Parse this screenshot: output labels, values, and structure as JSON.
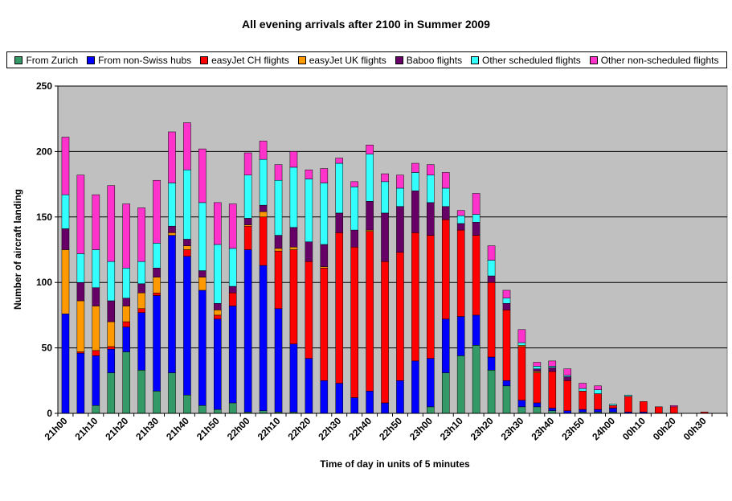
{
  "chart_data": {
    "type": "bar",
    "stacked": true,
    "title": "All evening arrivals after 2100 in Summer 2009",
    "xlabel": "Time of day in units of 5 minutes",
    "ylabel": "Number of aircraft landing",
    "ylim": [
      0,
      250
    ],
    "yticks": [
      0,
      50,
      100,
      150,
      200,
      250
    ],
    "grid": true,
    "legend_position": "top",
    "x_tick_labels": [
      "21h00",
      "21h10",
      "21h20",
      "21h30",
      "21h40",
      "21h50",
      "22h00",
      "22h10",
      "22h20",
      "22h30",
      "22h40",
      "22h50",
      "23h00",
      "23h10",
      "23h20",
      "23h30",
      "23h40",
      "23h50",
      "24h00",
      "00h10",
      "00h20",
      "00h30"
    ],
    "x_tick_every": 2,
    "categories": [
      "21h00",
      "21h05",
      "21h10",
      "21h15",
      "21h20",
      "21h25",
      "21h30",
      "21h35",
      "21h40",
      "21h45",
      "21h50",
      "21h55",
      "22h00",
      "22h05",
      "22h10",
      "22h15",
      "22h20",
      "22h25",
      "22h30",
      "22h35",
      "22h40",
      "22h45",
      "22h50",
      "22h55",
      "23h00",
      "23h05",
      "23h10",
      "23h15",
      "23h20",
      "23h25",
      "23h30",
      "23h35",
      "23h40",
      "23h45",
      "23h50",
      "23h55",
      "24h00",
      "00h05",
      "00h10",
      "00h15",
      "00h20",
      "00h25",
      "00h30",
      "00h35"
    ],
    "series": [
      {
        "name": "From Zurich",
        "color": "#339966",
        "values": [
          0,
          0,
          6,
          31,
          47,
          33,
          17,
          31,
          14,
          6,
          3,
          8,
          1,
          2,
          1,
          1,
          0,
          0,
          0,
          0,
          0,
          0,
          0,
          0,
          5,
          31,
          44,
          52,
          33,
          21,
          5,
          5,
          2,
          0,
          1,
          1,
          1,
          0,
          0,
          0,
          0,
          0,
          0,
          0
        ]
      },
      {
        "name": "From non-Swiss hubs",
        "color": "#0000FF",
        "values": [
          76,
          46,
          38,
          18,
          19,
          44,
          73,
          105,
          106,
          88,
          69,
          74,
          124,
          111,
          79,
          52,
          42,
          25,
          23,
          12,
          17,
          8,
          25,
          40,
          37,
          41,
          30,
          23,
          10,
          4,
          5,
          3,
          2,
          2,
          2,
          2,
          3,
          1,
          1,
          0,
          0,
          0,
          0,
          0
        ]
      },
      {
        "name": "easyJet CH flights",
        "color": "#FF0000",
        "values": [
          0,
          1,
          4,
          2,
          4,
          3,
          2,
          0,
          5,
          0,
          3,
          10,
          18,
          37,
          44,
          72,
          74,
          86,
          115,
          115,
          122,
          108,
          98,
          98,
          94,
          76,
          66,
          61,
          57,
          54,
          41,
          23,
          28,
          23,
          14,
          12,
          2,
          12,
          8,
          5,
          5,
          0,
          1,
          0
        ]
      },
      {
        "name": "easyJet UK flights",
        "color": "#FF9900",
        "values": [
          49,
          39,
          34,
          19,
          12,
          12,
          12,
          2,
          3,
          10,
          4,
          0,
          1,
          4,
          2,
          2,
          0,
          1,
          0,
          0,
          1,
          0,
          0,
          0,
          0,
          0,
          0,
          0,
          0,
          0,
          1,
          1,
          0,
          0,
          0,
          0,
          0,
          0,
          0,
          0,
          0,
          0,
          0,
          0
        ]
      },
      {
        "name": "Baboo flights",
        "color": "#660066",
        "values": [
          16,
          14,
          14,
          16,
          6,
          7,
          7,
          5,
          5,
          5,
          5,
          5,
          5,
          5,
          10,
          15,
          15,
          17,
          15,
          13,
          22,
          37,
          35,
          32,
          25,
          10,
          5,
          10,
          5,
          5,
          0,
          2,
          3,
          3,
          0,
          0,
          0,
          0,
          0,
          0,
          0,
          0,
          0,
          0
        ]
      },
      {
        "name": "Other scheduled flights",
        "color": "#33FFFF",
        "values": [
          26,
          22,
          29,
          30,
          23,
          17,
          19,
          33,
          53,
          52,
          45,
          29,
          33,
          35,
          42,
          46,
          48,
          47,
          38,
          33,
          36,
          24,
          14,
          14,
          21,
          14,
          6,
          6,
          12,
          4,
          2,
          2,
          1,
          1,
          2,
          3,
          1,
          1,
          0,
          0,
          0,
          0,
          0,
          0
        ]
      },
      {
        "name": "Other non-scheduled flights",
        "color": "#FF33CC",
        "values": [
          44,
          60,
          42,
          58,
          49,
          41,
          48,
          39,
          36,
          41,
          32,
          34,
          17,
          14,
          12,
          12,
          7,
          11,
          4,
          4,
          7,
          6,
          10,
          7,
          8,
          12,
          4,
          16,
          11,
          6,
          10,
          3,
          4,
          5,
          4,
          3,
          0,
          0,
          0,
          0,
          1,
          0,
          0,
          0
        ]
      }
    ]
  }
}
